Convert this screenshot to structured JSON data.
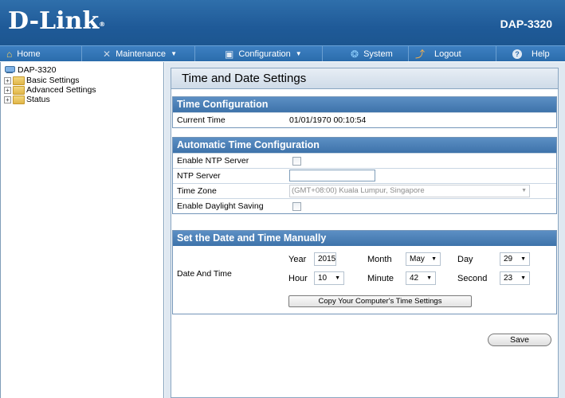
{
  "header": {
    "logo": "D-Link",
    "logo_mark": "®",
    "model": "DAP-3320"
  },
  "menu": [
    {
      "icon": "home-icon",
      "glyph": "⌂",
      "label": "Home",
      "caret": ""
    },
    {
      "icon": "wrench-icon",
      "glyph": "✕",
      "label": "Maintenance",
      "caret": "▼"
    },
    {
      "icon": "floppy-icon",
      "glyph": "▣",
      "label": "Configuration",
      "caret": "▼"
    },
    {
      "icon": "system-icon",
      "glyph": "❂",
      "label": "System",
      "caret": ""
    },
    {
      "icon": "logout-icon",
      "glyph": "⤴",
      "label": "Logout",
      "caret": ""
    },
    {
      "icon": "help-icon",
      "glyph": "?",
      "label": "Help",
      "caret": ""
    }
  ],
  "tree": {
    "root": "DAP-3320",
    "items": [
      "Basic Settings",
      "Advanced Settings",
      "Status"
    ]
  },
  "page": {
    "title": "Time and Date Settings"
  },
  "time_config": {
    "heading": "Time Configuration",
    "current_time_label": "Current Time",
    "current_time_value": "01/01/1970 00:10:54"
  },
  "auto_config": {
    "heading": "Automatic Time Configuration",
    "enable_ntp_label": "Enable NTP Server",
    "ntp_server_label": "NTP Server",
    "ntp_server_value": "",
    "time_zone_label": "Time Zone",
    "time_zone_value": "(GMT+08:00) Kuala Lumpur, Singapore",
    "daylight_label": "Enable Daylight Saving"
  },
  "manual": {
    "heading": "Set the Date and Time Manually",
    "date_time_label": "Date And Time",
    "year_label": "Year",
    "year_value": "2015",
    "month_label": "Month",
    "month_value": "May",
    "day_label": "Day",
    "day_value": "29",
    "hour_label": "Hour",
    "hour_value": "10",
    "minute_label": "Minute",
    "minute_value": "42",
    "second_label": "Second",
    "second_value": "23",
    "copy_button": "Copy Your Computer's Time Settings"
  },
  "save_button": "Save",
  "colors": {
    "header": "#1f5a98",
    "menubar": "#2b6cab",
    "section_head": "#4a7fb6"
  }
}
